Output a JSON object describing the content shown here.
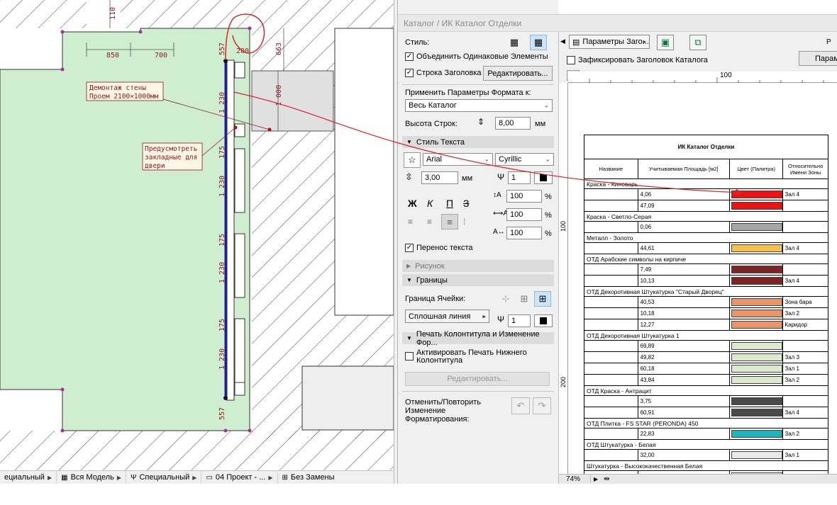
{
  "drawing": {
    "dims": {
      "d110": "110",
      "d850": "850",
      "d700": "700",
      "d557a": "557",
      "d200": "200",
      "d663": "663",
      "d1000": "1 000",
      "d1230a": "1 230",
      "d175a": "175",
      "d1230b": "1 230",
      "d175b": "175",
      "d1230c": "1 230",
      "d175c": "175",
      "d1230d": "1 230",
      "d557b": "557"
    },
    "notes": {
      "demolition": [
        "Демонтаж стены",
        "Проем 2100×1000мм"
      ],
      "embedded": [
        "Предусмотреть",
        "закладные для",
        "двери"
      ]
    },
    "colors": {
      "room_fill": "#cfeecf",
      "annotation": "#c0392b",
      "wall_line": "#1a1ab0",
      "hatch": "#333333"
    }
  },
  "statusbar": {
    "items": [
      {
        "icon": "",
        "label": "ециальный"
      },
      {
        "icon": "layers-icon",
        "label": "Вся Модель"
      },
      {
        "icon": "pen-icon",
        "label": "Специальный"
      },
      {
        "icon": "view-icon",
        "label": "04 Проект - ..."
      },
      {
        "icon": "override-icon",
        "label": "Без Замены"
      }
    ]
  },
  "settings": {
    "window_title": "Каталог / ИК Каталог Отделки",
    "style_label": "Стиль:",
    "merge_label": "Объединить Одинаковые Элементы",
    "merge_checked": true,
    "header_row_label": "Строка Заголовка",
    "header_row_checked": true,
    "edit_button": "Редактировать...",
    "apply_format_label": "Применить Параметры Формата к:",
    "apply_format_value": "Весь Каталог",
    "row_height_label": "Высота Строк:",
    "row_height_value": "8,00",
    "row_height_unit": "мм",
    "text_style_section": "Стиль Текста",
    "font_value": "Arial",
    "charset_value": "Cyrillic",
    "font_size_value": "3,00",
    "font_size_unit": "мм",
    "pen_value": "1",
    "bold_label": "Ж",
    "italic_label": "К",
    "underline_label": "П",
    "strike_label": "З",
    "spacing1_value": "100",
    "spacing2_value": "100",
    "spacing3_value": "100",
    "percent": "%",
    "wrap_label": "Перенос текста",
    "wrap_checked": true,
    "picture_section": "Рисунок",
    "borders_section": "Границы",
    "cell_border_label": "Граница Ячейки:",
    "line_type_value": "Сплошная линия",
    "border_pen_value": "1",
    "header_footer_section": "Печать Колонтитула и Изменение Фор...",
    "footer_label": "Активировать Печать Нижнего Колонтитула",
    "footer_checked": false,
    "edit_disabled_button": "Редактировать...",
    "undo_redo_label": "Отменить/Повторить Изменение Форматирования:"
  },
  "preview": {
    "params_dropdown": "Параметры Заго...",
    "fix_header_label": "Зафиксировать Заголовок Каталога",
    "fix_header_checked": false,
    "right_button": "Парам",
    "ellipsis_button": "...",
    "ruler_h_label": "100",
    "ruler_v_labels": [
      "100",
      "200"
    ],
    "zoom_value": "74%",
    "corner_label": "Р"
  },
  "schedule": {
    "title": "ИК Каталог Отделки",
    "headers": [
      "Название",
      "Учитываемая Площадь [м2]",
      "Цвет (Палитра)",
      "Относительно Имени Зоны"
    ],
    "groups": [
      {
        "name": "Краска - Киноварь",
        "rows": [
          {
            "area": "4,06",
            "color": "#ee1111",
            "zone": "Зал 4"
          },
          {
            "area": "47,09",
            "color": "#ee1111",
            "zone": ""
          }
        ]
      },
      {
        "name": "Краска - Светло-Серая",
        "rows": [
          {
            "area": "0,06",
            "color": "#a6a6a6",
            "zone": ""
          }
        ]
      },
      {
        "name": "Металл - Золото",
        "rows": [
          {
            "area": "44,61",
            "color": "#f7c04a",
            "zone": "Зал 4"
          }
        ]
      },
      {
        "name": "ОТД Арабские символы на кирпиче",
        "rows": [
          {
            "area": "7,49",
            "color": "#7f2424",
            "zone": ""
          },
          {
            "area": "10,13",
            "color": "#7f2424",
            "zone": "Зал 4"
          }
        ]
      },
      {
        "name": "ОТД Декоротивная Штукатурка \"Старый Дворец\"",
        "rows": [
          {
            "area": "40,53",
            "color": "#e8956a",
            "zone": "Зона бара"
          },
          {
            "area": "10,18",
            "color": "#e8956a",
            "zone": "Зал 2"
          },
          {
            "area": "12,27",
            "color": "#e8956a",
            "zone": "Каридор"
          }
        ]
      },
      {
        "name": "ОТД Декоротивная Штукатурка 1",
        "rows": [
          {
            "area": "69,89",
            "color": "#dde8cf",
            "zone": ""
          },
          {
            "area": "49,82",
            "color": "#dde8cf",
            "zone": "Зал 3"
          },
          {
            "area": "60,18",
            "color": "#dde8cf",
            "zone": "Зал 1"
          },
          {
            "area": "43,84",
            "color": "#dde8cf",
            "zone": "Зал 2"
          }
        ]
      },
      {
        "name": "ОТД Краска - Антрацит",
        "rows": [
          {
            "area": "3,75",
            "color": "#4a4a4a",
            "zone": ""
          },
          {
            "area": "60,91",
            "color": "#4a4a4a",
            "zone": "Зал 4"
          }
        ]
      },
      {
        "name": "ОТД Плитка - FS STAR (PERONDA) 450",
        "rows": [
          {
            "area": "22,83",
            "color": "#1fb5b9",
            "zone": "Зал 2"
          }
        ]
      },
      {
        "name": "ОТД Штукатурка - Белая",
        "rows": [
          {
            "area": "32,00",
            "color": "#e8e8e8",
            "zone": "Зал 1"
          }
        ]
      },
      {
        "name": "Штукатурка - Высококачественная Белая",
        "rows": [
          {
            "area": "33,67",
            "color": "#e8e8e8",
            "zone": ""
          }
        ]
      }
    ]
  }
}
